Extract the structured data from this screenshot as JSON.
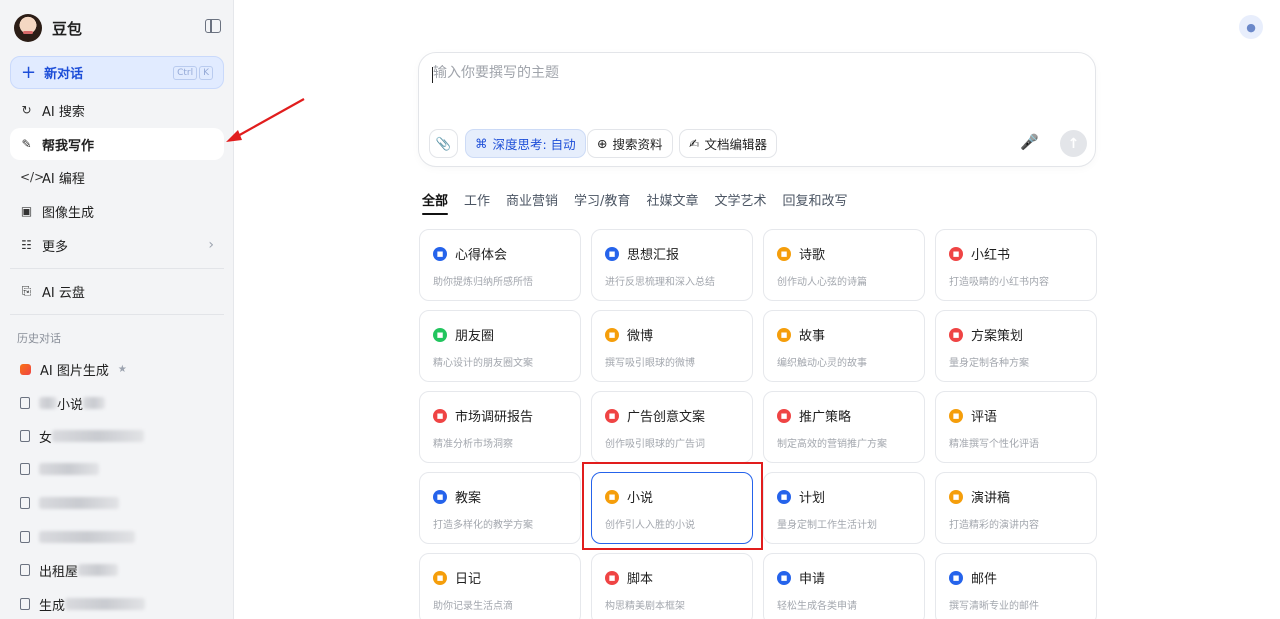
{
  "sidebar": {
    "brand": "豆包",
    "new_chat": {
      "label": "新对话",
      "shortcut": [
        "Ctrl",
        "K"
      ]
    },
    "nav": [
      {
        "label": "AI 搜索",
        "icon": "search-icon"
      },
      {
        "label": "帮我写作",
        "icon": "pen-icon"
      },
      {
        "label": "AI 编程",
        "icon": "code-icon"
      },
      {
        "label": "图像生成",
        "icon": "image-icon"
      },
      {
        "label": "更多",
        "icon": "grid-icon"
      }
    ],
    "cloud": {
      "label": "AI 云盘",
      "icon": "cloud-drive-icon"
    },
    "history_label": "历史对话",
    "history": [
      {
        "label": "AI 图片生成"
      },
      {
        "label": "小说"
      },
      {
        "label": "女"
      },
      {
        "label": ""
      },
      {
        "label": ""
      },
      {
        "label": ""
      },
      {
        "label": "出租屋"
      },
      {
        "label": "生成"
      }
    ]
  },
  "composer": {
    "placeholder": "输入你要撰写的主题",
    "tools": {
      "deep_think": "深度思考: 自动",
      "search": "搜索资料",
      "doc_editor": "文档编辑器"
    }
  },
  "tabs": [
    "全部",
    "工作",
    "商业营销",
    "学习/教育",
    "社媒文章",
    "文学艺术",
    "回复和改写"
  ],
  "cards": [
    {
      "title": "心得体会",
      "desc": "助你提炼归纳所感所悟",
      "color": "#2563eb"
    },
    {
      "title": "思想汇报",
      "desc": "进行反思梳理和深入总结",
      "color": "#2563eb"
    },
    {
      "title": "诗歌",
      "desc": "创作动人心弦的诗篇",
      "color": "#f59e0b"
    },
    {
      "title": "小红书",
      "desc": "打造吸睛的小红书内容",
      "color": "#ef4444"
    },
    {
      "title": "朋友圈",
      "desc": "精心设计的朋友圈文案",
      "color": "#22c55e"
    },
    {
      "title": "微博",
      "desc": "撰写吸引眼球的微博",
      "color": "#f59e0b"
    },
    {
      "title": "故事",
      "desc": "编织触动心灵的故事",
      "color": "#f59e0b"
    },
    {
      "title": "方案策划",
      "desc": "量身定制各种方案",
      "color": "#ef4444"
    },
    {
      "title": "市场调研报告",
      "desc": "精准分析市场洞察",
      "color": "#ef4444"
    },
    {
      "title": "广告创意文案",
      "desc": "创作吸引眼球的广告词",
      "color": "#ef4444"
    },
    {
      "title": "推广策略",
      "desc": "制定高效的营销推广方案",
      "color": "#ef4444"
    },
    {
      "title": "评语",
      "desc": "精准撰写个性化评语",
      "color": "#f59e0b"
    },
    {
      "title": "教案",
      "desc": "打造多样化的教学方案",
      "color": "#2563eb"
    },
    {
      "title": "小说",
      "desc": "创作引人入胜的小说",
      "color": "#f59e0b"
    },
    {
      "title": "计划",
      "desc": "量身定制工作生活计划",
      "color": "#2563eb"
    },
    {
      "title": "演讲稿",
      "desc": "打造精彩的演讲内容",
      "color": "#f59e0b"
    },
    {
      "title": "日记",
      "desc": "助你记录生活点滴",
      "color": "#f59e0b"
    },
    {
      "title": "脚本",
      "desc": "构思精美剧本框架",
      "color": "#ef4444"
    },
    {
      "title": "申请",
      "desc": "轻松生成各类申请",
      "color": "#2563eb"
    },
    {
      "title": "邮件",
      "desc": "撰写清晰专业的邮件",
      "color": "#2563eb"
    }
  ],
  "selected_card": "小说",
  "colors": {
    "accent": "#2563eb",
    "annotation": "#e11d1d"
  }
}
